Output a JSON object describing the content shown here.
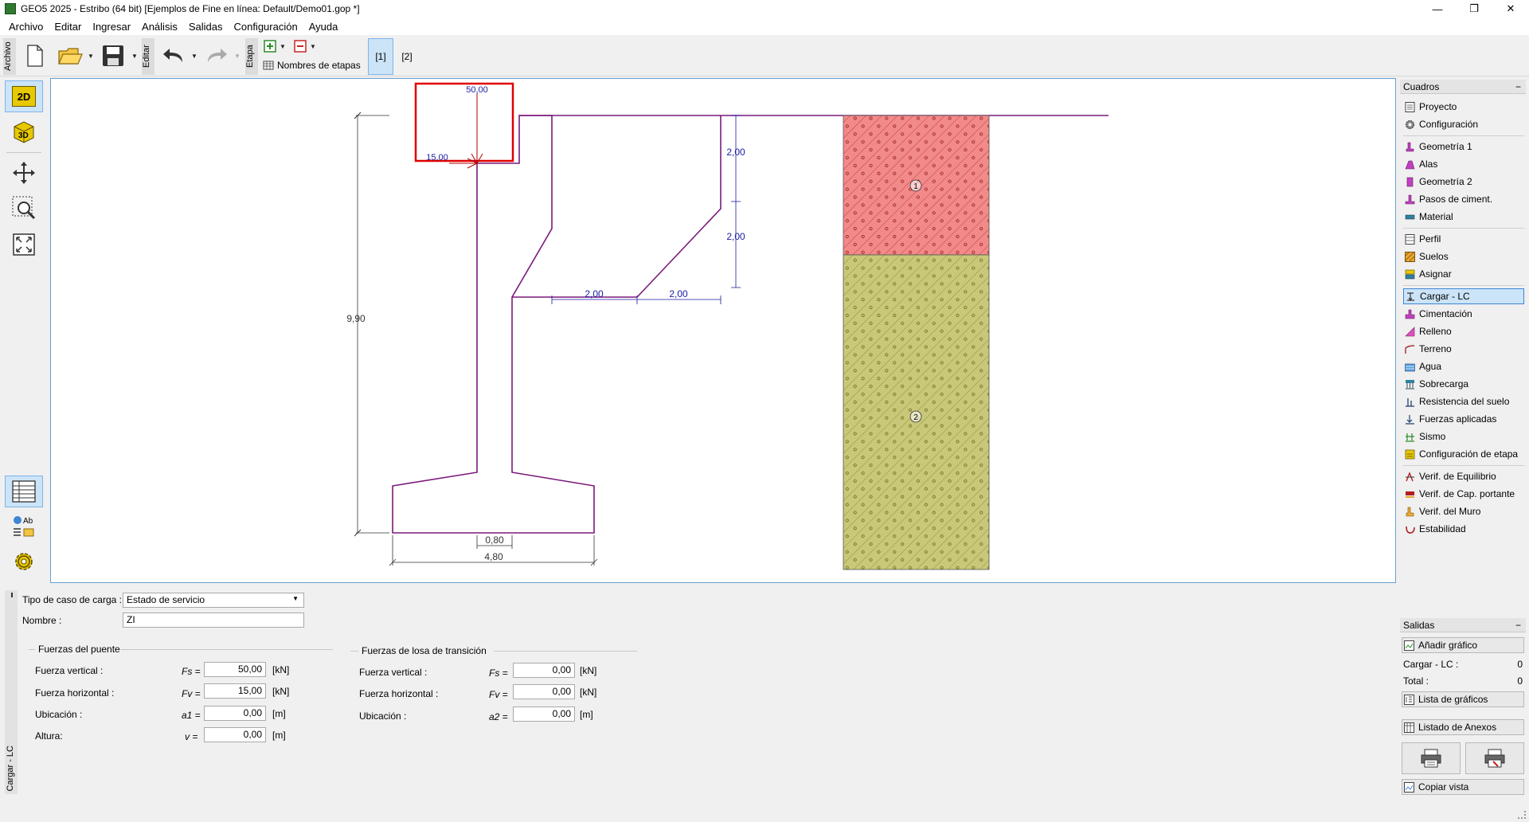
{
  "window": {
    "title": "GEO5 2025 - Estribo (64 bit) [Ejemplos de Fine en línea: Default/Demo01.gop *]",
    "minimize": "—",
    "restore": "❐",
    "close": "✕"
  },
  "menu": [
    "Archivo",
    "Editar",
    "Ingresar",
    "Análisis",
    "Salidas",
    "Configuración",
    "Ayuda"
  ],
  "toolbar": {
    "archivo_label": "Archivo",
    "editar_label": "Editar",
    "etapa_label": "Etapa",
    "stage_names_label": "Nombres de etapas",
    "stages": [
      "[1]",
      "[2]"
    ],
    "active_stage": "[1]"
  },
  "left_tools": {
    "btn_2d": "2D",
    "btn_3d": "3D",
    "btn_ab": "Ab"
  },
  "drawing": {
    "load_fs": "50,00",
    "load_fv": "15,00",
    "dim_height": "9,90",
    "dim_upper": "2,00",
    "dim_lower": "2,00",
    "dim_h1": "2,00",
    "dim_h2": "2,00",
    "dim_stem": "0,80",
    "dim_base": "4,80",
    "soil_labels": [
      "1",
      "2"
    ],
    "colors": {
      "structure": "#7a1a7a",
      "dimension": "#1a1aa0",
      "load": "#b00000",
      "highlight": "#e00000",
      "soil1": "#f08080",
      "soil2": "#c0c060"
    }
  },
  "form": {
    "load_type_label": "Tipo de caso de carga :",
    "load_type_value": "Estado de servicio",
    "name_label": "Nombre :",
    "name_value": "ZI",
    "bridge_group": "Fuerzas del puente",
    "bridge": [
      {
        "label": "Fuerza vertical :",
        "sym": "Fs =",
        "value": "50,00",
        "unit": "[kN]"
      },
      {
        "label": "Fuerza horizontal :",
        "sym": "Fv =",
        "value": "15,00",
        "unit": "[kN]"
      },
      {
        "label": "Ubicación :",
        "sym": "a1 =",
        "value": "0,00",
        "unit": "[m]"
      },
      {
        "label": "Altura:",
        "sym": "v =",
        "value": "0,00",
        "unit": "[m]"
      }
    ],
    "slab_group": "Fuerzas de losa de transición",
    "slab": [
      {
        "label": "Fuerza vertical :",
        "sym": "Fs =",
        "value": "0,00",
        "unit": "[kN]"
      },
      {
        "label": "Fuerza horizontal :",
        "sym": "Fv =",
        "value": "0,00",
        "unit": "[kN]"
      },
      {
        "label": "Ubicación :",
        "sym": "a2 =",
        "value": "0,00",
        "unit": "[m]"
      }
    ],
    "side_tab": "Cargar - LC"
  },
  "right_panel": {
    "cuadros_title": "Cuadros",
    "items_group1": [
      "Proyecto",
      "Configuración"
    ],
    "items_group2": [
      "Geometría 1",
      "Alas",
      "Geometría 2",
      "Pasos de ciment.",
      "Material"
    ],
    "items_group3": [
      "Perfil",
      "Suelos",
      "Asignar"
    ],
    "items_group4": [
      "Cargar - LC",
      "Cimentación",
      "Relleno",
      "Terreno",
      "Agua",
      "Sobrecarga",
      "Resistencia del suelo",
      "Fuerzas aplicadas",
      "Sismo",
      "Configuración de etapa"
    ],
    "items_group5": [
      "Verif. de Equilibrio",
      "Verif. de Cap. portante",
      "Verif. del Muro",
      "Estabilidad"
    ],
    "selected": "Cargar - LC",
    "salidas_title": "Salidas",
    "add_graphic": "Añadir gráfico",
    "count_label": "Cargar - LC :",
    "count_value": "0",
    "total_label": "Total :",
    "total_value": "0",
    "graphics_list": "Lista de gráficos",
    "annex_list": "Listado de Anexos",
    "copy_view": "Copiar vista"
  }
}
